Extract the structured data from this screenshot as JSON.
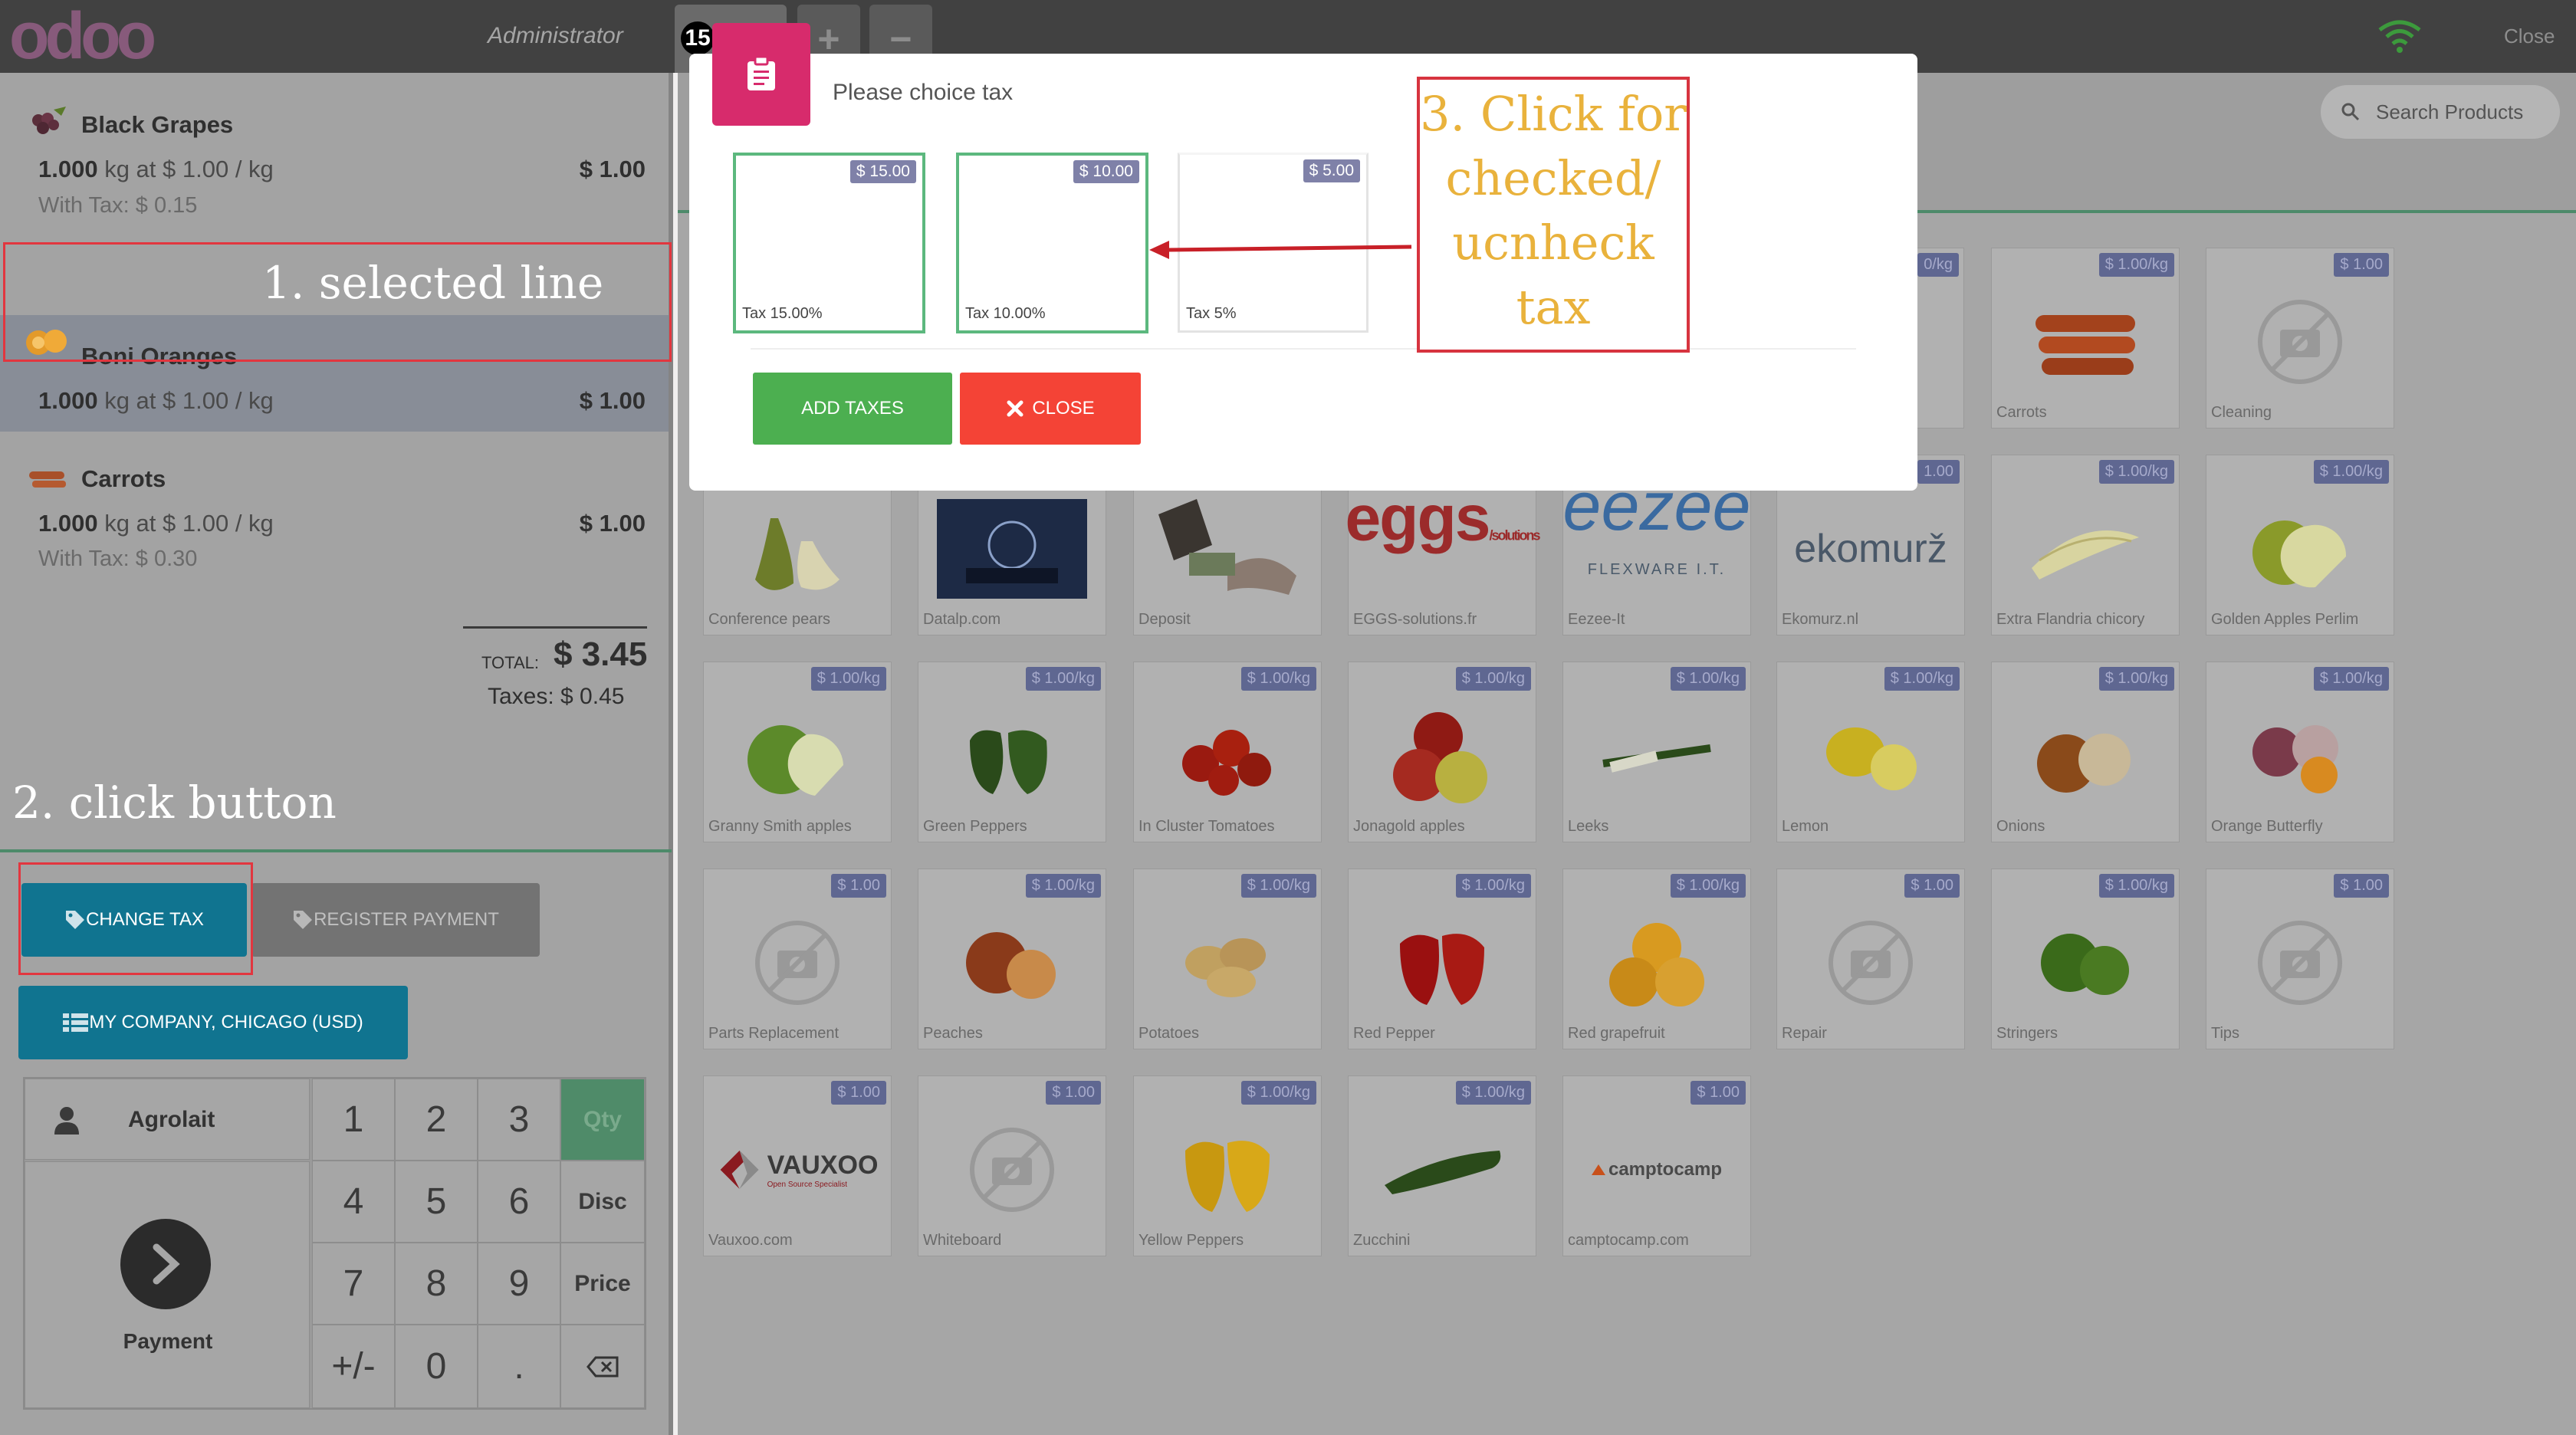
{
  "app": {
    "logo": "odoo",
    "user": "Administrator",
    "order_number": "15",
    "add_order": "+",
    "remove_order": "−",
    "close_label": "Close"
  },
  "order_lines": [
    {
      "name": "Black Grapes",
      "qty": "1.000",
      "qty_rest": "kg at $ 1.00 / kg",
      "price": "$ 1.00",
      "with_tax": "With Tax: $ 0.15"
    },
    {
      "name": "Boni Oranges",
      "qty": "1.000",
      "qty_rest": "kg at $ 1.00 / kg",
      "price": "$ 1.00",
      "with_tax": ""
    },
    {
      "name": "Carrots",
      "qty": "1.000",
      "qty_rest": "kg at $ 1.00 / kg",
      "price": "$ 1.00",
      "with_tax": "With Tax: $ 0.30"
    }
  ],
  "totals": {
    "total_label": "TOTAL:",
    "total_value": "$ 3.45",
    "taxes": "Taxes: $ 0.45"
  },
  "actions": {
    "change_tax": "CHANGE TAX",
    "register_payment": "REGISTER PAYMENT",
    "company": "MY COMPANY, CHICAGO (USD)"
  },
  "numpad": {
    "customer": "Agrolait",
    "payment": "Payment",
    "keys": [
      "1",
      "2",
      "3",
      "4",
      "5",
      "6",
      "7",
      "8",
      "9",
      "+/-",
      "0",
      "."
    ],
    "modes": {
      "qty": "Qty",
      "disc": "Disc",
      "price": "Price"
    }
  },
  "annotations": {
    "a1": "1. selected line",
    "a2": "2. click button",
    "a3_lines": [
      "3. Click for",
      "checked/",
      "ucnheck",
      "tax"
    ]
  },
  "search": {
    "placeholder": "Search Products"
  },
  "products": [
    {
      "name": "Carrots",
      "price": "$ 1.00/kg"
    },
    {
      "name": "Cleaning",
      "price": "$ 1.00"
    },
    {
      "name": "Conference pears",
      "price": ""
    },
    {
      "name": "Datalp.com",
      "price": ""
    },
    {
      "name": "Deposit",
      "price": ""
    },
    {
      "name": "EGGS-solutions.fr",
      "price": ""
    },
    {
      "name": "Eezee-It",
      "price": ""
    },
    {
      "name": "Ekomurz.nl",
      "price": "$ 1.00"
    },
    {
      "name": "Extra Flandria chicory",
      "price": "$ 1.00/kg"
    },
    {
      "name": "Golden Apples Perlim",
      "price": "$ 1.00/kg"
    },
    {
      "name": "Granny Smith apples",
      "price": "$ 1.00/kg"
    },
    {
      "name": "Green Peppers",
      "price": "$ 1.00/kg"
    },
    {
      "name": "In Cluster Tomatoes",
      "price": "$ 1.00/kg"
    },
    {
      "name": "Jonagold apples",
      "price": "$ 1.00/kg"
    },
    {
      "name": "Leeks",
      "price": "$ 1.00/kg"
    },
    {
      "name": "Lemon",
      "price": "$ 1.00/kg"
    },
    {
      "name": "Onions",
      "price": "$ 1.00/kg"
    },
    {
      "name": "Orange Butterfly",
      "price": "$ 1.00/kg"
    },
    {
      "name": "Parts Replacement",
      "price": "$ 1.00"
    },
    {
      "name": "Peaches",
      "price": "$ 1.00/kg"
    },
    {
      "name": "Potatoes",
      "price": "$ 1.00/kg"
    },
    {
      "name": "Red Pepper",
      "price": "$ 1.00/kg"
    },
    {
      "name": "Red grapefruit",
      "price": "$ 1.00/kg"
    },
    {
      "name": "Repair",
      "price": "$ 1.00"
    },
    {
      "name": "Stringers",
      "price": "$ 1.00/kg"
    },
    {
      "name": "Tips",
      "price": "$ 1.00"
    },
    {
      "name": "Vauxoo.com",
      "price": "$ 1.00"
    },
    {
      "name": "Whiteboard",
      "price": "$ 1.00"
    },
    {
      "name": "Yellow Peppers",
      "price": "$ 1.00/kg"
    },
    {
      "name": "Zucchini",
      "price": "$ 1.00/kg"
    },
    {
      "name": "camptocamp.com",
      "price": "$ 1.00"
    }
  ],
  "partial_tiles": {
    "t1_price": "0/kg",
    "t2_price": "1.00",
    "logo_eggs": "eggs",
    "logo_eggs_sub": "/solutions",
    "logo_eezee": "eezee",
    "logo_eezee_sub": "FLEXWARE I.T.",
    "logo_ekomurz": "ekomurž",
    "logo_vauxoo": "VAUXOO",
    "logo_vauxoo_sub": "Open Source Specialist",
    "logo_camptocamp": "camptocamp"
  },
  "modal": {
    "title": "Please choice tax",
    "taxes": [
      {
        "badge": "$ 15.00",
        "label": "Tax 15.00%",
        "checked": true
      },
      {
        "badge": "$ 10.00",
        "label": "Tax 10.00%",
        "checked": true
      },
      {
        "badge": "$ 5.00",
        "label": "Tax 5%",
        "checked": false
      }
    ],
    "add_taxes": "ADD TAXES",
    "close": "CLOSE"
  },
  "colors": {
    "topbar": "#414141",
    "accent_teal": "#107490",
    "modal_icon": "#d72b6c",
    "add_green": "#4caf50",
    "close_red": "#f44336",
    "annotation_red": "#e2363f",
    "annotation_yellow": "#e9b23c"
  }
}
